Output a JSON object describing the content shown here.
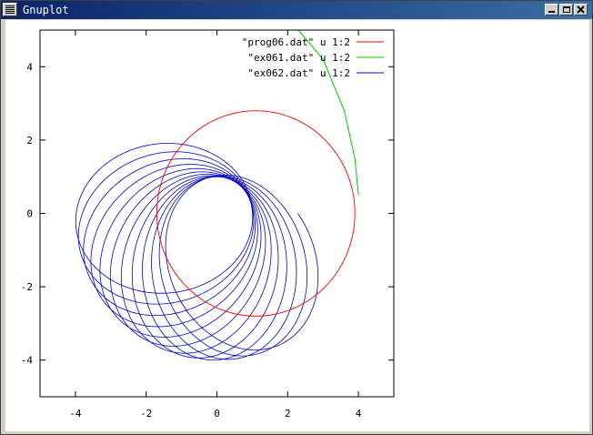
{
  "window": {
    "title": "Gnuplot"
  },
  "chart_data": {
    "type": "line",
    "xlim": [
      -5,
      5
    ],
    "ylim": [
      -5,
      5
    ],
    "xticks": [
      "-4",
      "-2",
      "0",
      "2",
      "4"
    ],
    "yticks": [
      "4",
      "2",
      "0",
      "-2",
      "-4"
    ],
    "legend_position": "top-right",
    "series": [
      {
        "name": "\"prog06.dat\" u 1:2",
        "color": "#ff0000",
        "shape": "circle",
        "center": [
          1.1,
          0
        ],
        "radius": 2.8
      },
      {
        "name": "\"ex061.dat\" u 1:2",
        "color": "#00cc00",
        "shape": "arc",
        "points": [
          [
            4.0,
            0.5
          ],
          [
            3.9,
            1.5
          ],
          [
            3.6,
            2.8
          ],
          [
            3.0,
            4.2
          ],
          [
            2.3,
            5.0
          ]
        ]
      },
      {
        "name": "\"ex062.dat\" u 1:2",
        "color": "#0000cc",
        "shape": "precessing-orbit",
        "rmin": 1.0,
        "rmax": 4.0,
        "orbits": 12,
        "precession_deg": 10
      }
    ]
  }
}
